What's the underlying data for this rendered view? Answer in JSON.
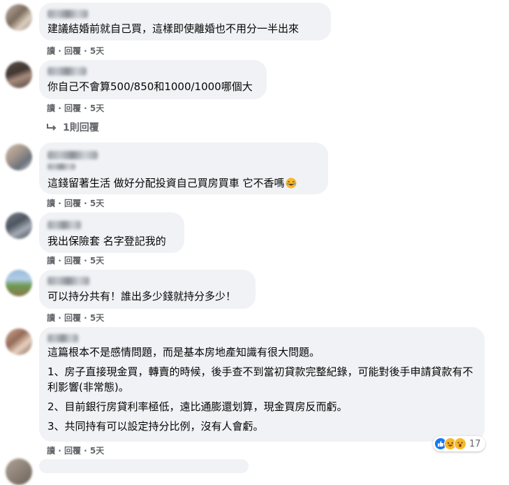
{
  "comments": [
    {
      "text": "建議結婚前就自己買，這樣即使離婚也不用分一半出來",
      "meta": {
        "read": "讀",
        "reply": "回覆",
        "time": "5天"
      }
    },
    {
      "text": "你自己不會算500/850和1000/1000哪個大",
      "meta": {
        "read": "讀",
        "reply": "回覆",
        "time": "5天"
      },
      "replies_label": "1則回覆"
    },
    {
      "text": "這錢留著生活 做好分配投資自己買房買車 它不香嗎",
      "meta": {
        "read": "讀",
        "reply": "回覆",
        "time": "5天"
      },
      "emoji": "rolling-laughing-emoji"
    },
    {
      "text": "我出保險套 名字登記我的",
      "meta": {
        "read": "讀",
        "reply": "回覆",
        "time": "5天"
      }
    },
    {
      "text": "可以持分共有！誰出多少錢就持分多少！",
      "meta": {
        "read": "讀",
        "reply": "回覆",
        "time": "5天"
      }
    },
    {
      "lines": [
        "這篇根本不是感情問題，而是基本房地產知識有很大問題。",
        "1、房子直接現金買，轉賣的時候，後手查不到當初貸款完整紀錄，可能對後手申請貸款有不利影響(非常態)。",
        "2、目前銀行房貸利率極低，遠比通膨還划算，現金買房反而虧。",
        "3、共同持有可以設定持分比例，沒有人會虧。"
      ],
      "meta": {
        "read": "讀",
        "reply": "回覆",
        "time": "5天"
      },
      "reactions": {
        "icons": [
          "like",
          "haha",
          "wow"
        ],
        "count": "17"
      }
    }
  ],
  "colors": {
    "bubble": "#f0f2f5",
    "meta": "#65676b",
    "like": "#1877f2",
    "emoji": "#f7b928"
  }
}
